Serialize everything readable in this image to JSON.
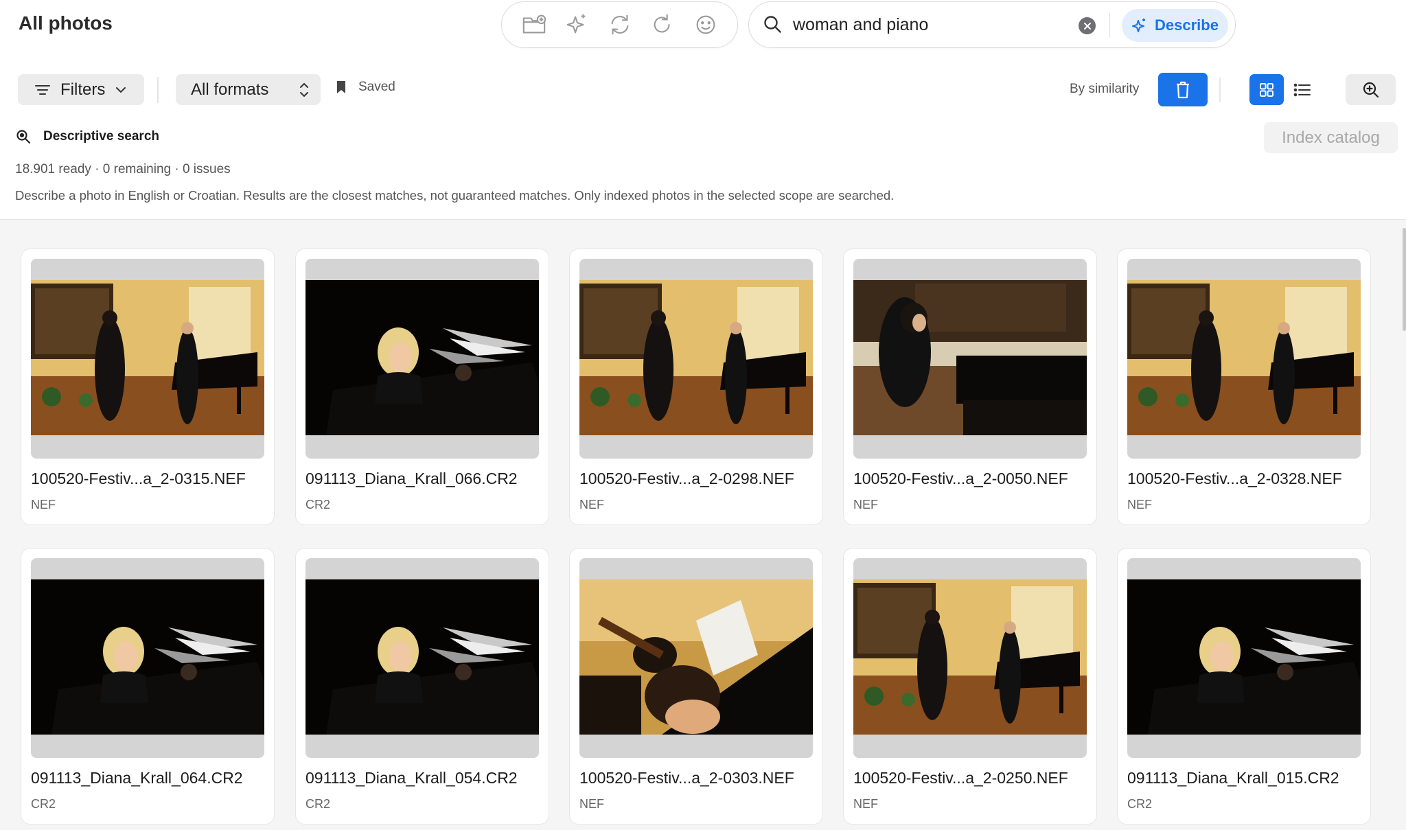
{
  "header": {
    "title": "All photos"
  },
  "toolbar": {
    "icons": [
      "folder-add-icon",
      "sparkle-icon",
      "sync-icon",
      "rotate-icon",
      "face-icon"
    ]
  },
  "search": {
    "value": "woman and piano",
    "describe_label": "Describe"
  },
  "filterbar": {
    "filters_label": "Filters",
    "formats_value": "All formats",
    "saved_label": "Saved",
    "sort_label": "By similarity"
  },
  "panel": {
    "title": "Descriptive search",
    "index_button": "Index catalog",
    "status": "18.901 ready · 0 remaining · 0 issues",
    "help": "Describe a photo in English or Croatian. Results are the closest matches, not guaranteed matches. Only indexed photos in the selected scope are searched."
  },
  "colors": {
    "accent": "#1a73e8",
    "accent_light": "#e3eefc"
  },
  "photos": [
    {
      "name": "100520-Festiv...a_2-0315.NEF",
      "type": "NEF",
      "scene": "hall"
    },
    {
      "name": "091113_Diana_Krall_066.CR2",
      "type": "CR2",
      "scene": "stage"
    },
    {
      "name": "100520-Festiv...a_2-0298.NEF",
      "type": "NEF",
      "scene": "hall"
    },
    {
      "name": "100520-Festiv...a_2-0050.NEF",
      "type": "NEF",
      "scene": "pianist"
    },
    {
      "name": "100520-Festiv...a_2-0328.NEF",
      "type": "NEF",
      "scene": "hall"
    },
    {
      "name": "091113_Diana_Krall_064.CR2",
      "type": "CR2",
      "scene": "stage"
    },
    {
      "name": "091113_Diana_Krall_054.CR2",
      "type": "CR2",
      "scene": "stage"
    },
    {
      "name": "100520-Festiv...a_2-0303.NEF",
      "type": "NEF",
      "scene": "closeup"
    },
    {
      "name": "100520-Festiv...a_2-0250.NEF",
      "type": "NEF",
      "scene": "hall"
    },
    {
      "name": "091113_Diana_Krall_015.CR2",
      "type": "CR2",
      "scene": "stage"
    }
  ]
}
